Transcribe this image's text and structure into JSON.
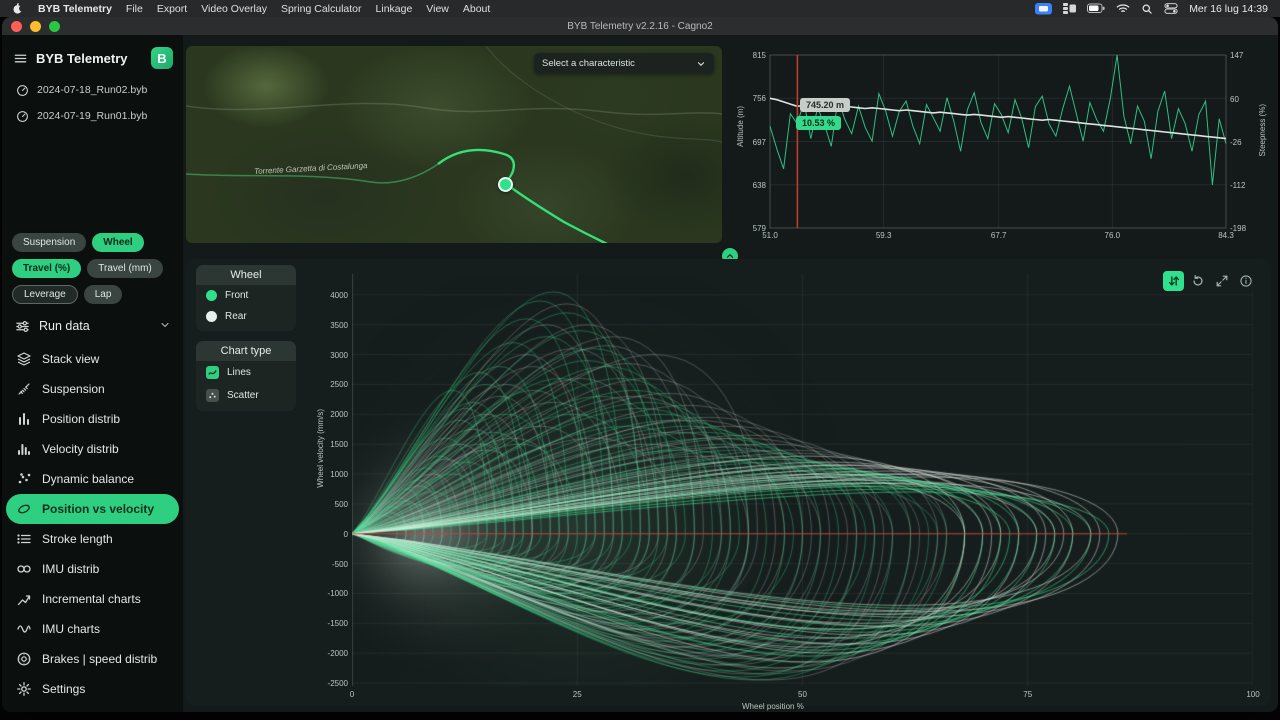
{
  "menubar": {
    "app_name": "BYB Telemetry",
    "items": [
      "File",
      "Export",
      "Video Overlay",
      "Spring Calculator",
      "Linkage",
      "View",
      "About"
    ],
    "clock": "Mer 16 lug 14:39"
  },
  "window": {
    "title": "BYB Telemetry v2.2.16 - Cagno2"
  },
  "sidebar": {
    "app_title": "BYB Telemetry",
    "logo_letter": "B",
    "runs": [
      "2024-07-18_Run02.byb",
      "2024-07-19_Run01.byb"
    ],
    "toggles": {
      "suspension": "Suspension",
      "wheel": "Wheel",
      "travel_pct": "Travel (%)",
      "travel_mm": "Travel (mm)",
      "leverage": "Leverage",
      "lap": "Lap"
    },
    "run_data_label": "Run data",
    "nav": [
      {
        "label": "Stack view"
      },
      {
        "label": "Suspension"
      },
      {
        "label": "Position distrib"
      },
      {
        "label": "Velocity distrib"
      },
      {
        "label": "Dynamic balance"
      },
      {
        "label": "Position vs velocity",
        "active": true
      },
      {
        "label": "Stroke length"
      },
      {
        "label": "IMU distrib"
      },
      {
        "label": "Incremental charts"
      },
      {
        "label": "IMU charts"
      },
      {
        "label": "Brakes | speed distrib"
      }
    ],
    "settings_label": "Settings"
  },
  "map": {
    "dropdown_placeholder": "Select a characteristic",
    "place_label": "Torrente Garzetta di Costalunga"
  },
  "main_chart": {
    "wheel_panel": {
      "title": "Wheel",
      "options": [
        "Front",
        "Rear"
      ]
    },
    "chart_type_panel": {
      "title": "Chart type",
      "options": [
        "Lines",
        "Scatter"
      ]
    }
  },
  "chart_data": [
    {
      "type": "line",
      "name": "altitude-steepness",
      "x_range": [
        51.0,
        84.3
      ],
      "x_ticks": [
        51.0,
        59.3,
        67.7,
        76.0,
        84.3
      ],
      "x_tick_labels": [
        "51.0",
        "59.3",
        "67.7",
        "76.0",
        "84.3"
      ],
      "left_axis": {
        "label": "Altitude (m)",
        "range": [
          579,
          815
        ],
        "ticks": [
          815,
          756,
          697,
          638,
          579
        ]
      },
      "right_axis": {
        "label": "Steepness (%)",
        "range": [
          -198,
          147
        ],
        "ticks": [
          147,
          60,
          -26,
          -112,
          -198
        ]
      },
      "cursor_x": 53.0,
      "tooltip": {
        "altitude": "745.20 m",
        "steepness": "10.53 %"
      },
      "series": [
        {
          "name": "Altitude",
          "color": "#dde4e0",
          "width": 1.6,
          "values": [
            756,
            754,
            751,
            748,
            745,
            746,
            748,
            747,
            746,
            745,
            744,
            745,
            744,
            743,
            742,
            743,
            742,
            741,
            740,
            739,
            740,
            739,
            738,
            737,
            736,
            737,
            736,
            735,
            734,
            733,
            734,
            733,
            732,
            731,
            730,
            731,
            730,
            729,
            728,
            727,
            726,
            727,
            726,
            725,
            724,
            723,
            722,
            721,
            720,
            719,
            718,
            717,
            716,
            715,
            714,
            713,
            712,
            711,
            710,
            709,
            708,
            707,
            706,
            705,
            704,
            703,
            702,
            701
          ]
        },
        {
          "name": "Steepness",
          "color": "#2fbf83",
          "width": 1,
          "values": [
            5,
            -40,
            -80,
            30,
            10,
            53,
            -20,
            42,
            8,
            -35,
            60,
            18,
            -10,
            45,
            2,
            -25,
            70,
            35,
            -15,
            35,
            55,
            5,
            -30,
            48,
            22,
            -5,
            62,
            15,
            -45,
            38,
            72,
            12,
            -20,
            50,
            28,
            -8,
            58,
            20,
            -38,
            44,
            65,
            10,
            -15,
            40,
            85,
            30,
            -25,
            52,
            18,
            -5,
            60,
            147,
            25,
            -30,
            45,
            15,
            -60,
            35,
            75,
            -20,
            40,
            10,
            -45,
            28,
            55,
            -112,
            20,
            -30
          ]
        }
      ]
    },
    {
      "type": "line",
      "name": "position-vs-velocity",
      "xlabel": "Wheel position %",
      "ylabel": "Wheel velocity (mm/s)",
      "xlim": [
        0,
        100
      ],
      "ylim": [
        -2550,
        4350
      ],
      "x_ticks": [
        0,
        25,
        50,
        75,
        100
      ],
      "y_ticks": [
        4000,
        3500,
        3000,
        2500,
        2000,
        1500,
        1000,
        500,
        0,
        -500,
        -1000,
        -1500,
        -2000,
        -2500
      ],
      "zero_line": {
        "color": "#c44536",
        "y": 0,
        "x_extent": 86
      },
      "loops_format": "[max_position_pct, peak_velocity, min_velocity]",
      "series": [
        {
          "name": "Front",
          "color": "#43e492",
          "loops": [
            [
              5,
              300,
              -200
            ],
            [
              6,
              450,
              -250
            ],
            [
              7,
              600,
              -300
            ],
            [
              8,
              750,
              -350
            ],
            [
              9,
              500,
              -280
            ],
            [
              10,
              900,
              -400
            ],
            [
              11,
              1100,
              -450
            ],
            [
              12,
              700,
              -380
            ],
            [
              13,
              1300,
              -500
            ],
            [
              14,
              1600,
              -550
            ],
            [
              15,
              1000,
              -480
            ],
            [
              16,
              1900,
              -600
            ],
            [
              17,
              1200,
              -520
            ],
            [
              18,
              2200,
              -650
            ],
            [
              19,
              1500,
              -580
            ],
            [
              20,
              2500,
              -700
            ],
            [
              22,
              2800,
              -750
            ],
            [
              24,
              3200,
              -800
            ],
            [
              26,
              3600,
              -850
            ],
            [
              28,
              3900,
              -900
            ],
            [
              30,
              4050,
              -1000
            ],
            [
              32,
              3700,
              -1100
            ],
            [
              34,
              3400,
              -1200
            ],
            [
              36,
              3100,
              -1300
            ],
            [
              38,
              2800,
              -1400
            ],
            [
              40,
              2600,
              -1500
            ],
            [
              42,
              2400,
              -1600
            ],
            [
              44,
              2200,
              -1700
            ],
            [
              46,
              2000,
              -1800
            ],
            [
              48,
              1900,
              -1900
            ],
            [
              50,
              1800,
              -2000
            ],
            [
              52,
              1700,
              -2100
            ],
            [
              54,
              1600,
              -2200
            ],
            [
              56,
              1500,
              -2300
            ],
            [
              58,
              1400,
              -2400
            ],
            [
              60,
              1300,
              -2450
            ],
            [
              62,
              1250,
              -2350
            ],
            [
              64,
              1200,
              -2250
            ],
            [
              66,
              1150,
              -2150
            ],
            [
              68,
              1100,
              -2050
            ],
            [
              70,
              1050,
              -1950
            ],
            [
              72,
              1000,
              -1850
            ],
            [
              74,
              950,
              -1750
            ],
            [
              76,
              900,
              -1650
            ],
            [
              78,
              850,
              -1550
            ],
            [
              80,
              800,
              -1450
            ],
            [
              82,
              750,
              -1350
            ],
            [
              84,
              700,
              -1250
            ],
            [
              25,
              1500,
              -900
            ],
            [
              33,
              2000,
              -1000
            ],
            [
              41,
              1800,
              -1200
            ],
            [
              49,
              1400,
              -1500
            ],
            [
              57,
              1200,
              -1800
            ],
            [
              65,
              900,
              -2000
            ],
            [
              73,
              800,
              -1600
            ],
            [
              31,
              2600,
              -700
            ],
            [
              37,
              2300,
              -900
            ],
            [
              43,
              2100,
              -1100
            ],
            [
              29,
              3300,
              -600
            ],
            [
              35,
              2900,
              -800
            ],
            [
              27,
              2400,
              -500
            ],
            [
              23,
              2000,
              -450
            ],
            [
              21,
              1700,
              -400
            ],
            [
              19,
              2700,
              -350
            ],
            [
              17,
              2100,
              -300
            ],
            [
              15,
              2400,
              -250
            ]
          ]
        },
        {
          "name": "Rear",
          "color": "#eef4f0",
          "loops": [
            [
              6,
              350,
              -220
            ],
            [
              8,
              550,
              -300
            ],
            [
              10,
              800,
              -380
            ],
            [
              12,
              1000,
              -430
            ],
            [
              14,
              1250,
              -480
            ],
            [
              16,
              1500,
              -530
            ],
            [
              18,
              1750,
              -580
            ],
            [
              20,
              2000,
              -630
            ],
            [
              23,
              2500,
              -700
            ],
            [
              26,
              3000,
              -800
            ],
            [
              29,
              3500,
              -900
            ],
            [
              32,
              3850,
              -1000
            ],
            [
              35,
              3500,
              -1150
            ],
            [
              38,
              3150,
              -1300
            ],
            [
              41,
              2850,
              -1450
            ],
            [
              44,
              2600,
              -1600
            ],
            [
              47,
              2350,
              -1750
            ],
            [
              50,
              2150,
              -1900
            ],
            [
              53,
              1950,
              -2050
            ],
            [
              56,
              1800,
              -2200
            ],
            [
              59,
              1650,
              -2350
            ],
            [
              62,
              1500,
              -2450
            ],
            [
              65,
              1400,
              -2300
            ],
            [
              68,
              1300,
              -2150
            ],
            [
              71,
              1200,
              -2000
            ],
            [
              74,
              1150,
              -1850
            ],
            [
              77,
              1100,
              -1700
            ],
            [
              80,
              1050,
              -1550
            ],
            [
              83,
              1000,
              -1400
            ],
            [
              85,
              950,
              -1300
            ],
            [
              28,
              1800,
              -950
            ],
            [
              36,
              1600,
              -1250
            ],
            [
              44,
              1500,
              -1550
            ],
            [
              52,
              1300,
              -1850
            ],
            [
              60,
              1100,
              -2100
            ],
            [
              68,
              950,
              -1900
            ],
            [
              76,
              850,
              -1500
            ],
            [
              30,
              2200,
              -850
            ],
            [
              34,
              2600,
              -750
            ],
            [
              42,
              2300,
              -1350
            ],
            [
              24,
              1600,
              -600
            ],
            [
              20,
              1400,
              -520
            ],
            [
              48,
              1700,
              -1650
            ],
            [
              55,
              1450,
              -1950
            ],
            [
              63,
              1250,
              -2250
            ],
            [
              70,
              1000,
              -1750
            ],
            [
              78,
              900,
              -1350
            ],
            [
              82,
              850,
              -1200
            ],
            [
              45,
              3000,
              -1400
            ],
            [
              39,
              3300,
              -1100
            ],
            [
              27,
              2800,
              -650
            ],
            [
              22,
              2300,
              -550
            ],
            [
              33,
              3100,
              -950
            ],
            [
              51,
              1900,
              -1750
            ],
            [
              58,
              1600,
              -2050
            ],
            [
              66,
              1350,
              -1850
            ],
            [
              72,
              1150,
              -1600
            ],
            [
              79,
              1000,
              -1300
            ]
          ]
        }
      ]
    }
  ]
}
